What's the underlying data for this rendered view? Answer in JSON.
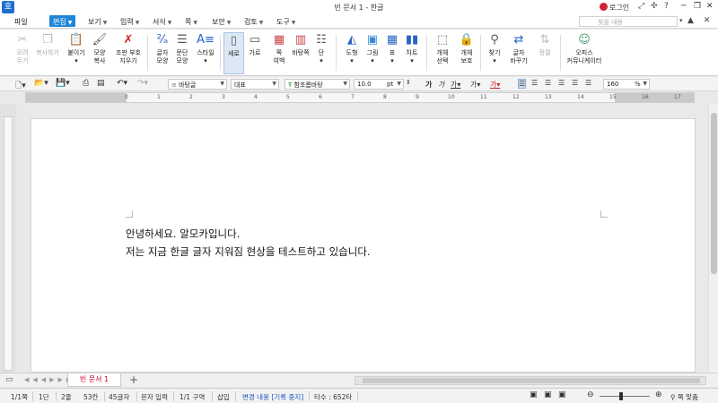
{
  "window": {
    "app_icon": "호",
    "title": "빈 문서 1 - 한글",
    "login_label": "로그인",
    "controls": [
      "─",
      "❐",
      "✕"
    ]
  },
  "menubar": {
    "items": [
      {
        "label": "파일",
        "has_caret": false
      },
      {
        "label": "편집",
        "has_caret": true,
        "active": true
      },
      {
        "label": "보기",
        "has_caret": true
      },
      {
        "label": "입력",
        "has_caret": true
      },
      {
        "label": "서식",
        "has_caret": true
      },
      {
        "label": "쪽",
        "has_caret": true
      },
      {
        "label": "보안",
        "has_caret": true
      },
      {
        "label": "검토",
        "has_caret": true
      },
      {
        "label": "도구",
        "has_caret": true
      }
    ],
    "search_placeholder": "찾을 내용"
  },
  "ribbon": {
    "cut": {
      "line1": "오려",
      "line2": "두기"
    },
    "copy": {
      "line1": "복사하기",
      "line2": ""
    },
    "paste": {
      "line1": "붙이기",
      "line2": ""
    },
    "shape_copy": {
      "line1": "모양",
      "line2": "복사"
    },
    "delete_marks": {
      "line1": "조판 부호",
      "line2": "지우기"
    },
    "char_shape": {
      "line1": "글자",
      "line2": "모양"
    },
    "para_shape": {
      "line1": "문단",
      "line2": "모양"
    },
    "style": {
      "line1": "스타일",
      "line2": ""
    },
    "portrait": {
      "line1": "세로",
      "line2": ""
    },
    "landscape": {
      "line1": "가로",
      "line2": ""
    },
    "margins": {
      "line1": "쪽",
      "line2": "여백"
    },
    "background": {
      "line1": "바탕쪽",
      "line2": ""
    },
    "columns": {
      "line1": "단",
      "line2": ""
    },
    "shape": {
      "line1": "도형",
      "line2": ""
    },
    "picture": {
      "line1": "그림",
      "line2": ""
    },
    "table": {
      "line1": "표",
      "line2": ""
    },
    "chart": {
      "line1": "차트",
      "line2": ""
    },
    "select_object": {
      "line1": "개체",
      "line2": "선택"
    },
    "protect_object": {
      "line1": "개체",
      "line2": "보호"
    },
    "find": {
      "line1": "찾기",
      "line2": ""
    },
    "replace": {
      "line1": "글자",
      "line2": "바꾸기"
    },
    "merge": {
      "line1": "정렬",
      "line2": ""
    },
    "office": {
      "line1": "오피스",
      "line2": "커뮤니케이터"
    }
  },
  "formatbar": {
    "style_name": "바탕글",
    "language": "대표",
    "font_name": "함초롬바탕",
    "font_size": "10.0",
    "size_unit": "pt",
    "zoom": "160",
    "zoom_unit": "%"
  },
  "ruler": {
    "numbers": [
      "0",
      "1",
      "2",
      "3",
      "4",
      "5",
      "6",
      "7",
      "8",
      "9",
      "10",
      "11",
      "12",
      "13",
      "14",
      "15",
      "16",
      "17"
    ]
  },
  "document": {
    "line1": "안녕하세요. 알모카입니다.",
    "line2": "저는 지금 한글 글자 지워짐 현상을 테스트하고 있습니다."
  },
  "tabs": {
    "doc_tab": "빈 문서 1",
    "add_tab": "+"
  },
  "statusbar": {
    "page": "1/1쪽",
    "section": "1단",
    "line": "2줄",
    "column": "53칸",
    "chars": "45글자",
    "input_mode": "문자 입력",
    "area": "1/1 구역",
    "insert": "삽입",
    "change_tracking": "변경 내용 [기록 중지]",
    "typing_count": "타수 : 652타",
    "fit_page_label": "쪽 맞춤"
  }
}
